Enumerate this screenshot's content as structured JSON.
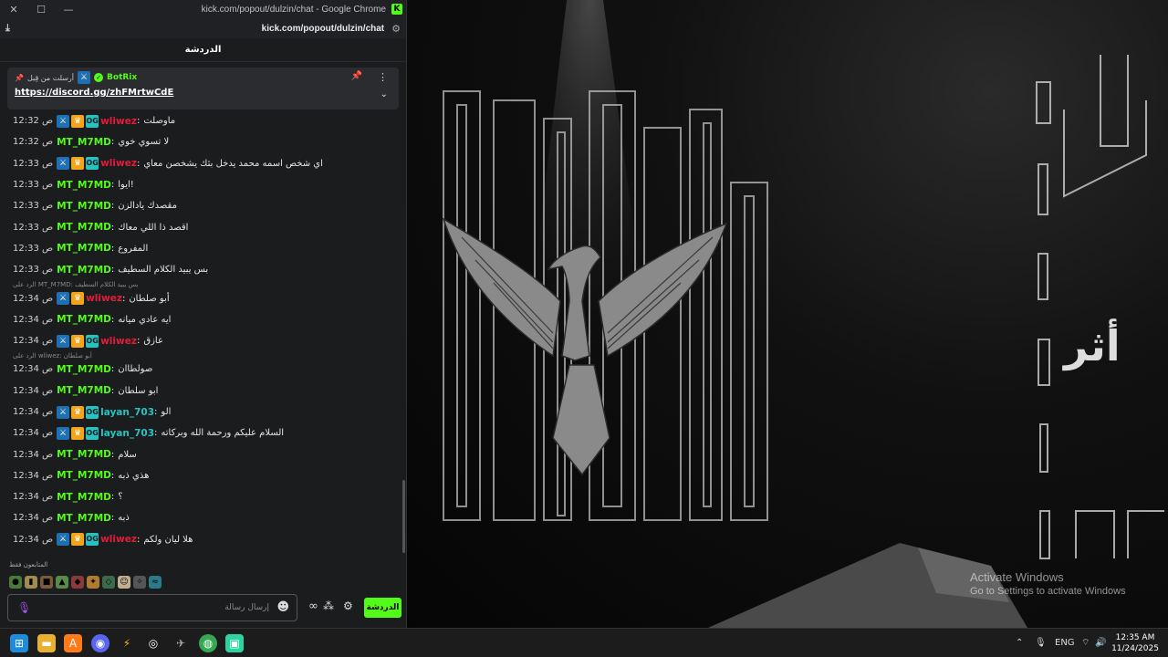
{
  "window": {
    "title": "kick.com/popout/dulzin/chat - Google Chrome",
    "url": "kick.com/popout/dulzin/chat"
  },
  "chat": {
    "header": "الدردشة",
    "pinned": {
      "label": "أرسلت من قِبل",
      "author": "BotRix",
      "link": "https://discord.gg/zhFMrtwCdE"
    },
    "messages": [
      {
        "time": "12:32 ص",
        "user": "wliwez",
        "color": "#e01e3c",
        "badges": [
          "mod",
          "vip",
          "og"
        ],
        "text": "ماوصلت"
      },
      {
        "time": "12:32 ص",
        "user": "MT_M7MD",
        "color": "#53fc18",
        "badges": [],
        "text": "لا تسوي خوي"
      },
      {
        "time": "12:33 ص",
        "user": "wliwez",
        "color": "#e01e3c",
        "badges": [
          "mod",
          "vip",
          "og"
        ],
        "text": "اي شخص اسمه محمد يدخل بثك يشخصن معاي"
      },
      {
        "time": "12:33 ص",
        "user": "MT_M7MD",
        "color": "#53fc18",
        "badges": [],
        "text": "ايوا!"
      },
      {
        "time": "12:33 ص",
        "user": "MT_M7MD",
        "color": "#53fc18",
        "badges": [],
        "text": "مقصدك يادالزن"
      },
      {
        "time": "12:33 ص",
        "user": "MT_M7MD",
        "color": "#53fc18",
        "badges": [],
        "text": "اقصد ذا اللي معاك"
      },
      {
        "time": "12:33 ص",
        "user": "MT_M7MD",
        "color": "#53fc18",
        "badges": [],
        "text": "المفروع"
      },
      {
        "time": "12:33 ص",
        "user": "MT_M7MD",
        "color": "#53fc18",
        "badges": [],
        "text": "بس يبيد الكلام السطيف"
      },
      {
        "reply": "الرد على MT_M7MD: بس يبيد الكلام السطيف",
        "time": "12:34 ص",
        "user": "wliwez",
        "color": "#e01e3c",
        "badges": [
          "mod",
          "vip"
        ],
        "text": "أبو صلطان"
      },
      {
        "time": "12:34 ص",
        "user": "MT_M7MD",
        "color": "#53fc18",
        "badges": [],
        "text": "ايه عادي ميانه"
      },
      {
        "time": "12:34 ص",
        "user": "wliwez",
        "color": "#e01e3c",
        "badges": [
          "mod",
          "vip",
          "og"
        ],
        "text": "عازق"
      },
      {
        "reply": "الرد على wliwez: أبو صلطان",
        "time": "12:34 ص",
        "user": "MT_M7MD",
        "color": "#53fc18",
        "badges": [],
        "text": "صولطاان"
      },
      {
        "time": "12:34 ص",
        "user": "MT_M7MD",
        "color": "#53fc18",
        "badges": [],
        "text": "ابو سلطان"
      },
      {
        "time": "12:34 ص",
        "user": "layan_703",
        "color": "#27c3c3",
        "badges": [
          "mod",
          "vip",
          "og"
        ],
        "text": "الو"
      },
      {
        "time": "12:34 ص",
        "user": "layan_703",
        "color": "#27c3c3",
        "badges": [
          "mod",
          "vip",
          "og"
        ],
        "text": "السلام عليكم ورحمة الله وبركاته"
      },
      {
        "time": "12:34 ص",
        "user": "MT_M7MD",
        "color": "#53fc18",
        "badges": [],
        "text": "سلام"
      },
      {
        "time": "12:34 ص",
        "user": "MT_M7MD",
        "color": "#53fc18",
        "badges": [],
        "text": "هذي ذبه"
      },
      {
        "time": "12:34 ص",
        "user": "MT_M7MD",
        "color": "#53fc18",
        "badges": [],
        "text": "؟"
      },
      {
        "time": "12:34 ص",
        "user": "MT_M7MD",
        "color": "#53fc18",
        "badges": [],
        "text": "ذبه"
      },
      {
        "time": "12:34 ص",
        "user": "wliwez",
        "color": "#e01e3c",
        "badges": [
          "mod",
          "vip",
          "og"
        ],
        "text": "هلا ليان ولكم"
      }
    ],
    "viewers_label": "المتابعون فقط",
    "input_placeholder": "إرسال رسالة",
    "send_label": "الدردشة"
  },
  "wallpaper": {
    "activate_title": "Activate Windows",
    "activate_sub": "Go to Settings to activate Windows",
    "art_text": "أثر"
  },
  "taskbar": {
    "lang": "ENG",
    "time": "12:35 AM",
    "date": "11/24/2025"
  }
}
